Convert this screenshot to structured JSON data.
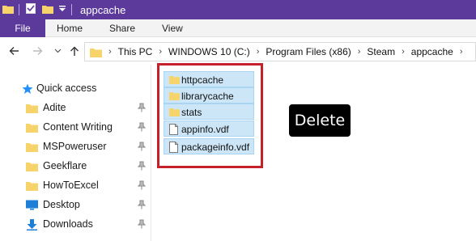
{
  "window": {
    "title": "appcache"
  },
  "colors": {
    "accent": "#5b3a9b",
    "selection": "#cce6f7",
    "highlight_border": "#c6202a",
    "folder": "#f6d36b"
  },
  "ribbon": {
    "file_label": "File",
    "tabs": [
      "Home",
      "Share",
      "View"
    ]
  },
  "address": {
    "crumbs": [
      "This PC",
      "WINDOWS 10 (C:)",
      "Program Files (x86)",
      "Steam",
      "appcache"
    ]
  },
  "nav_pane": {
    "quick_access_label": "Quick access",
    "items": [
      {
        "label": "Adite",
        "icon": "folder-icon",
        "pinned": true
      },
      {
        "label": "Content Writing",
        "icon": "folder-icon",
        "pinned": true
      },
      {
        "label": "MSPoweruser",
        "icon": "folder-icon",
        "pinned": true
      },
      {
        "label": "Geekflare",
        "icon": "folder-icon",
        "pinned": true
      },
      {
        "label": "HowToExcel",
        "icon": "folder-icon",
        "pinned": true
      },
      {
        "label": "Desktop",
        "icon": "desktop-icon",
        "pinned": true
      },
      {
        "label": "Downloads",
        "icon": "downloads-icon",
        "pinned": true
      }
    ]
  },
  "files": [
    {
      "name": "httpcache",
      "type": "folder"
    },
    {
      "name": "librarycache",
      "type": "folder"
    },
    {
      "name": "stats",
      "type": "folder"
    },
    {
      "name": "appinfo.vdf",
      "type": "file"
    },
    {
      "name": "packageinfo.vdf",
      "type": "file"
    }
  ],
  "overlay": {
    "delete_label": "Delete"
  }
}
